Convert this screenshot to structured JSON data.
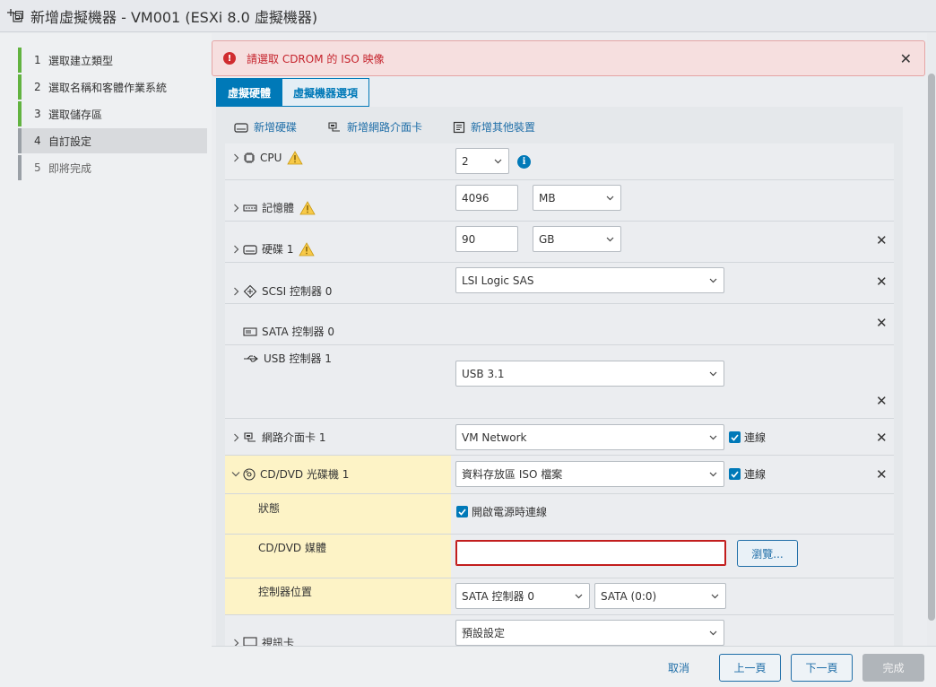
{
  "window": {
    "title": "新增虛擬機器 - VM001 (ESXi 8.0 虛擬機器)"
  },
  "steps": [
    {
      "num": "1",
      "label": "選取建立類型",
      "state": "done"
    },
    {
      "num": "2",
      "label": "選取名稱和客體作業系統",
      "state": "done"
    },
    {
      "num": "3",
      "label": "選取儲存區",
      "state": "done"
    },
    {
      "num": "4",
      "label": "自訂設定",
      "state": "current"
    },
    {
      "num": "5",
      "label": "即將完成",
      "state": "pending"
    }
  ],
  "alert": {
    "message": "請選取 CDROM 的 ISO 映像",
    "close": "✕"
  },
  "tabs": {
    "hardware": "虛擬硬體",
    "options": "虛擬機器選項"
  },
  "toolbar": {
    "add_disk": "新增硬碟",
    "add_nic": "新增網路介面卡",
    "add_other": "新增其他裝置"
  },
  "hw": {
    "cpu": {
      "label": "CPU",
      "value": "2"
    },
    "memory": {
      "label": "記憶體",
      "value": "4096",
      "unit": "MB"
    },
    "disk": {
      "label": "硬碟 1",
      "value": "90",
      "unit": "GB"
    },
    "scsi": {
      "label": "SCSI 控制器 0",
      "value": "LSI Logic SAS"
    },
    "sata": {
      "label": "SATA 控制器 0"
    },
    "usb": {
      "label": "USB 控制器 1",
      "value": "USB 3.1"
    },
    "nic": {
      "label": "網路介面卡 1",
      "value": "VM Network",
      "connect": "連線"
    },
    "cdrom": {
      "label": "CD/DVD 光碟機 1",
      "value": "資料存放區 ISO 檔案",
      "connect": "連線",
      "status_label": "狀態",
      "power_on_connect": "開啟電源時連線",
      "media_label": "CD/DVD 媒體",
      "media_value": "",
      "browse": "瀏覽...",
      "ctrl_label": "控制器位置",
      "ctrl_value": "SATA 控制器 0",
      "ctrl_slot": "SATA (0:0)"
    },
    "video": {
      "label": "視訊卡",
      "value": "預設設定"
    },
    "remove": "✕"
  },
  "footer": {
    "cancel": "取消",
    "back": "上一頁",
    "next": "下一頁",
    "finish": "完成"
  },
  "colors": {
    "accent": "#0079b8",
    "step_done": "#62b340",
    "error": "#c21d1d",
    "highlight": "#fdf3c6"
  }
}
